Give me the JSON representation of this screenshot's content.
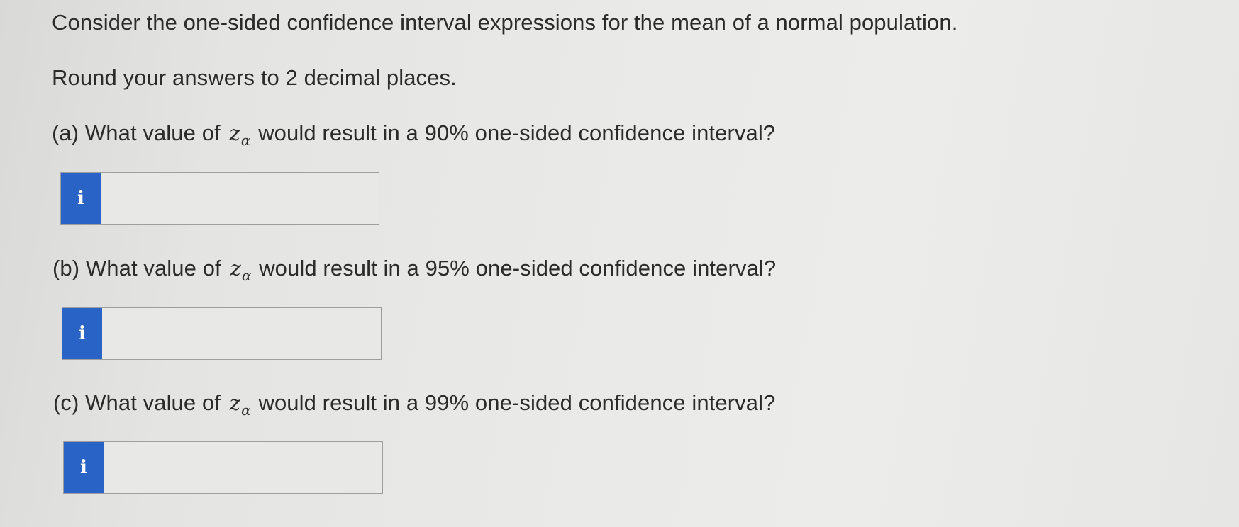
{
  "problem": {
    "intro": "Consider the one-sided confidence interval expressions for the mean of a normal population.",
    "instruction": "Round your answers to 2 decimal places."
  },
  "variable": {
    "symbol": "z",
    "subscript": "α"
  },
  "questions": [
    {
      "prefix": "(a) What value of",
      "suffix": "would result in a 90% one-sided confidence interval?",
      "answer_value": "",
      "info_icon": "i"
    },
    {
      "prefix": "(b) What value of",
      "suffix": "would result in a 95% one-sided confidence interval?",
      "answer_value": "",
      "info_icon": "i"
    },
    {
      "prefix": "(c) What value of",
      "suffix": "would result in a 99% one-sided confidence interval?",
      "answer_value": "",
      "info_icon": "i"
    }
  ],
  "colors": {
    "info_button": "#2a63c6",
    "background": "#e9e9e7"
  }
}
